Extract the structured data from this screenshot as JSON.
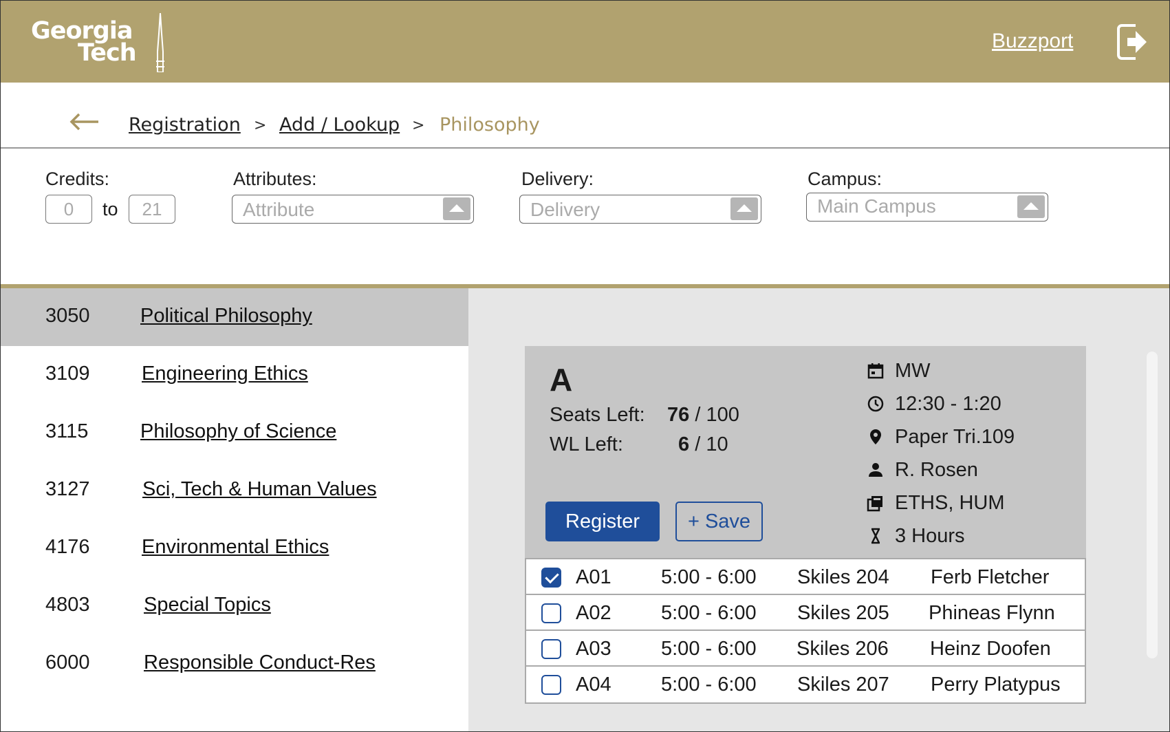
{
  "header": {
    "logo_line1": "Georgia",
    "logo_line2": "Tech",
    "buzzport_label": "Buzzport",
    "logout_icon": "logout-arrow-icon"
  },
  "breadcrumb": {
    "back_icon": "back-arrow-icon",
    "items": [
      "Registration",
      "Add / Lookup",
      "Philosophy"
    ],
    "separator": ">"
  },
  "filters": {
    "credits_label": "Credits:",
    "credits_min": "0",
    "credits_to": "to",
    "credits_max": "21",
    "attributes_label": "Attributes:",
    "attributes_placeholder": "Attribute",
    "delivery_label": "Delivery:",
    "delivery_placeholder": "Delivery",
    "campus_label": "Campus:",
    "campus_placeholder": "Main Campus"
  },
  "courses": [
    {
      "number": "3050",
      "title": "Political Philosophy",
      "selected": true
    },
    {
      "number": "3109",
      "title": "Engineering Ethics",
      "selected": false
    },
    {
      "number": "3115",
      "title": "Philosophy of Science",
      "selected": false
    },
    {
      "number": "3127",
      "title": "Sci, Tech & Human Values",
      "selected": false
    },
    {
      "number": "4176",
      "title": "Environmental Ethics",
      "selected": false
    },
    {
      "number": "4803",
      "title": "Special Topics",
      "selected": false
    },
    {
      "number": "6000",
      "title": "Responsible Conduct-Res",
      "selected": false
    }
  ],
  "section": {
    "letter": "A",
    "seats_label": "Seats Left:",
    "seats_left": "76",
    "seats_total": "100",
    "wl_label": "WL Left:",
    "wl_left": "6",
    "wl_total": "10",
    "slash": "/",
    "register_label": "Register",
    "save_label": "+ Save",
    "meta": {
      "days": "MW",
      "time": "12:30 - 1:20",
      "location": "Paper Tri.109",
      "instructor": "R. Rosen",
      "attributes": "ETHS, HUM",
      "hours": "3 Hours"
    }
  },
  "subsections": [
    {
      "code": "A01",
      "time": "5:00 - 6:00",
      "room": "Skiles 204",
      "instructor": "Ferb Fletcher",
      "checked": true
    },
    {
      "code": "A02",
      "time": "5:00 - 6:00",
      "room": "Skiles 205",
      "instructor": "Phineas Flynn",
      "checked": false
    },
    {
      "code": "A03",
      "time": "5:00 - 6:00",
      "room": "Skiles 206",
      "instructor": "Heinz Doofen",
      "checked": false
    },
    {
      "code": "A04",
      "time": "5:00 - 6:00",
      "room": "Skiles 207",
      "instructor": "Perry Platypus",
      "checked": false
    }
  ],
  "colors": {
    "gold": "#b1a26f",
    "navy": "#1f4e9a",
    "selected_row": "#c6c6c6",
    "pane_bg": "#e6e6e6"
  }
}
